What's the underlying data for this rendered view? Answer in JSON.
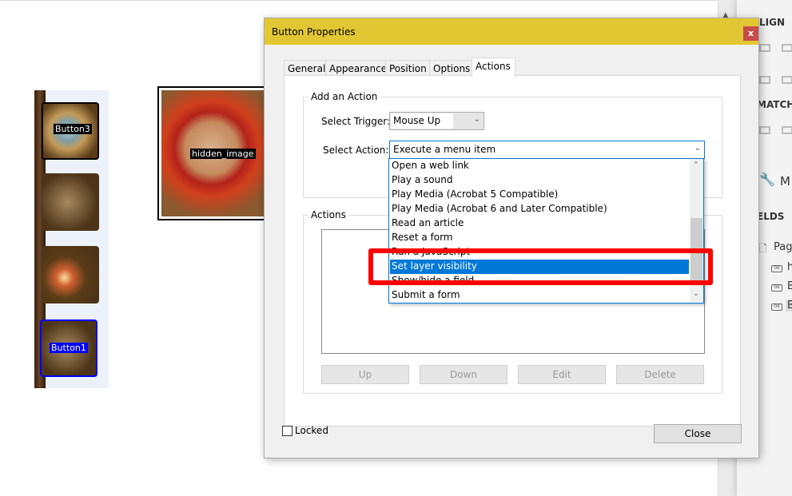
{
  "canvas": {
    "fields": [
      {
        "label": "Button3",
        "kind": "skull"
      },
      {
        "label": "",
        "kind": "chest"
      },
      {
        "label": "",
        "kind": "fireball"
      },
      {
        "label": "Button1",
        "kind": "claw",
        "selected": true
      }
    ],
    "image_field": "hidden_image"
  },
  "right_panel": {
    "align_heading": "LIGN",
    "match_heading": "MATCH S",
    "more_label": "M",
    "fields_heading": "ELDS",
    "tree": [
      "Pag",
      "h",
      "B",
      "B"
    ]
  },
  "dialog": {
    "title": "Button Properties",
    "close_icon": "close-icon",
    "tabs": [
      "General",
      "Appearance",
      "Position",
      "Options",
      "Actions"
    ],
    "active_tab": "Actions",
    "add_action": {
      "legend": "Add an Action",
      "trigger_label": "Select Trigger:",
      "trigger_value": "Mouse Up",
      "action_label": "Select Action:",
      "action_value": "Execute a menu item"
    },
    "action_options": [
      "Open a web link",
      "Play a sound",
      "Play Media (Acrobat 5 Compatible)",
      "Play Media (Acrobat 6 and Later Compatible)",
      "Read an article",
      "Reset a form",
      "Run a JavaScript",
      "Set layer visibility",
      "Show/hide a field",
      "Submit a form"
    ],
    "selected_option": "Set layer visibility",
    "highlight_color": "#ff0000",
    "actions": {
      "legend": "Actions",
      "buttons": [
        "Up",
        "Down",
        "Edit",
        "Delete"
      ]
    },
    "locked_label": "Locked",
    "locked_checked": false,
    "close_label": "Close"
  },
  "colors": {
    "titlebar": "#e2c733",
    "selection": "#0078d7",
    "close": "#c84b4b"
  }
}
